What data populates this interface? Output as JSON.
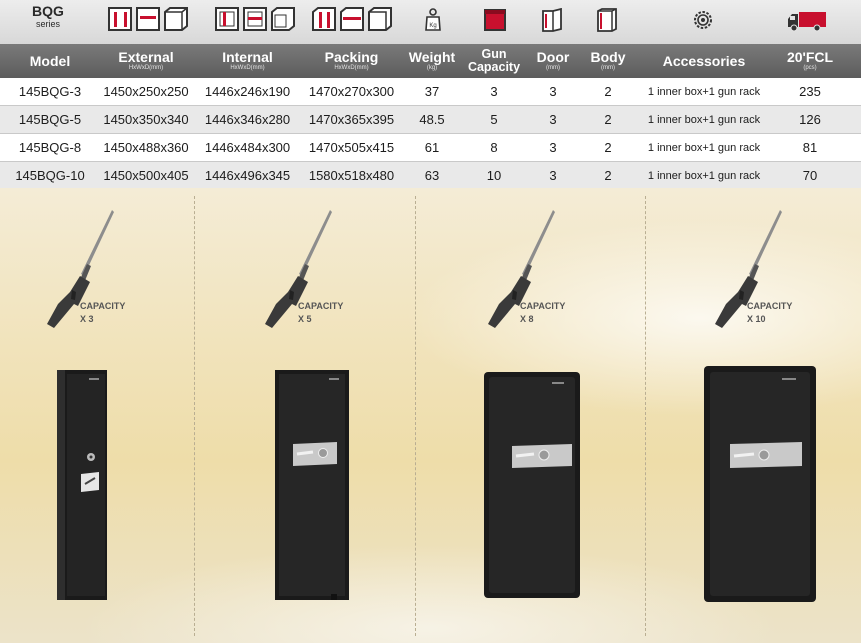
{
  "series": {
    "name": "BQG",
    "label": "series"
  },
  "columns": [
    {
      "id": "model",
      "title": "Model",
      "sub": ""
    },
    {
      "id": "external",
      "title": "External",
      "sub": "HxWxD(mm)"
    },
    {
      "id": "internal",
      "title": "Internal",
      "sub": "HxWxD(mm)"
    },
    {
      "id": "packing",
      "title": "Packing",
      "sub": "HxWxD(mm)"
    },
    {
      "id": "weight",
      "title": "Weight",
      "sub": "(kg)"
    },
    {
      "id": "gun",
      "title": "Gun",
      "title2": "Capacity",
      "sub": ""
    },
    {
      "id": "door",
      "title": "Door",
      "sub": "(mm)"
    },
    {
      "id": "body",
      "title": "Body",
      "sub": "(mm)"
    },
    {
      "id": "accessories",
      "title": "Accessories",
      "sub": ""
    },
    {
      "id": "fcl",
      "title": "20'FCL",
      "sub": "(pcs)"
    }
  ],
  "icons": {
    "external": "box-dimensions-icon",
    "internal": "box-interior-dimensions-icon",
    "packing": "package-dimensions-icon",
    "weight": "weight-icon",
    "gun": "gun-capacity-icon",
    "door": "door-thickness-icon",
    "body": "body-thickness-icon",
    "accessories": "accessories-gear-icon",
    "fcl": "container-truck-icon"
  },
  "rows": [
    {
      "model": "145BQG-3",
      "external": "1450x250x250",
      "internal": "1446x246x190",
      "packing": "1470x270x300",
      "weight": "37",
      "gun": "3",
      "door": "3",
      "body": "2",
      "accessories": "1 inner box+1 gun rack",
      "fcl": "235"
    },
    {
      "model": "145BQG-5",
      "external": "1450x350x340",
      "internal": "1446x346x280",
      "packing": "1470x365x395",
      "weight": "48.5",
      "gun": "5",
      "door": "3",
      "body": "2",
      "accessories": "1 inner box+1 gun rack",
      "fcl": "126"
    },
    {
      "model": "145BQG-8",
      "external": "1450x488x360",
      "internal": "1446x484x300",
      "packing": "1470x505x415",
      "weight": "61",
      "gun": "8",
      "door": "3",
      "body": "2",
      "accessories": "1 inner box+1 gun rack",
      "fcl": "81"
    },
    {
      "model": "145BQG-10",
      "external": "1450x500x405",
      "internal": "1446x496x345",
      "packing": "1580x518x480",
      "weight": "63",
      "gun": "10",
      "door": "3",
      "body": "2",
      "accessories": "1 inner box+1 gun rack",
      "fcl": "70"
    }
  ],
  "products": [
    {
      "capacity_label": "CAPACITY",
      "capacity_count": "X 3"
    },
    {
      "capacity_label": "CAPACITY",
      "capacity_count": "X 5"
    },
    {
      "capacity_label": "CAPACITY",
      "capacity_count": "X 8"
    },
    {
      "capacity_label": "CAPACITY",
      "capacity_count": "X 10"
    }
  ],
  "colors": {
    "header_bg": "#666666",
    "icon_bar_bg": "#e3e3e3",
    "alt_row_bg": "#e9e9e9",
    "safe_body": "#1e1e1e",
    "accent_red": "#c8102e",
    "band_bg": "#f1e3bb"
  }
}
